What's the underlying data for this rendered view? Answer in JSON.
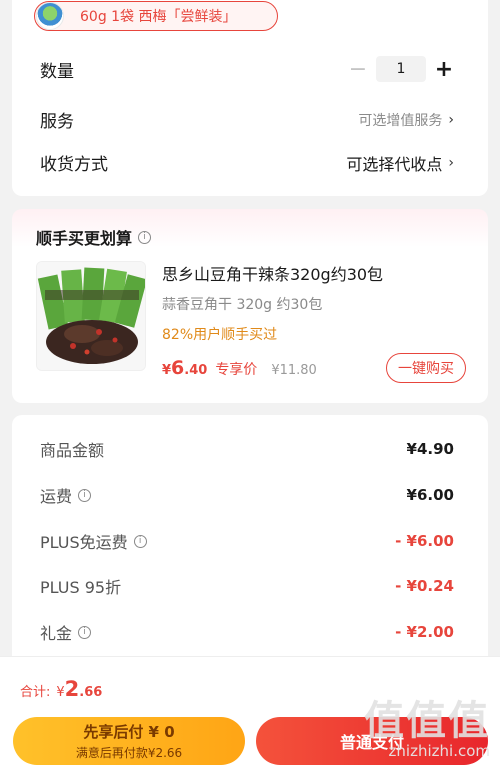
{
  "sku": {
    "text": "60g 1袋 西梅「尝鲜装」"
  },
  "order": {
    "quantity_label": "数量",
    "quantity_value": "1",
    "minus_symbol": "−",
    "plus_symbol": "+",
    "service_label": "服务",
    "service_value": "可选增值服务",
    "delivery_label": "收货方式",
    "delivery_value": "可选择代收点",
    "chevron": "›"
  },
  "upsell": {
    "title": "顺手买更划算",
    "product_title": "思乡山豆角干辣条320g约30包",
    "product_subtitle": "蒜香豆角干 320g 约30包",
    "tag": "82%用户顺手买过",
    "currency": "¥",
    "price_int": "6",
    "price_dec": ".40",
    "price_label": "专享价",
    "orig_price": "¥11.80",
    "buy_button": "一键购买"
  },
  "fees": [
    {
      "label": "商品金额",
      "value": "¥4.90",
      "info": false,
      "red": false
    },
    {
      "label": "运费",
      "value": "¥6.00",
      "info": true,
      "red": false
    },
    {
      "label": "PLUS免运费",
      "value": "- ¥6.00",
      "info": true,
      "red": true
    },
    {
      "label": "PLUS 95折",
      "value": "- ¥0.24",
      "info": false,
      "red": true
    },
    {
      "label": "礼金",
      "value": "- ¥2.00",
      "info": true,
      "red": true
    }
  ],
  "footer": {
    "total_label": "合计:",
    "total_currency": "¥",
    "total_int": "2",
    "total_dec": ".66",
    "later_line1": "先享后付 ¥ 0",
    "later_line2": "满意后再付款¥2.66",
    "pay_button": "普通支付"
  },
  "watermark": {
    "big": "值值值",
    "small": "zhizhizhi.com"
  },
  "colors": {
    "accent_red": "#e7453c",
    "accent_orange": "#e08a1a",
    "later_button": "#ffb51e",
    "pay_button": "#ee3a33"
  }
}
